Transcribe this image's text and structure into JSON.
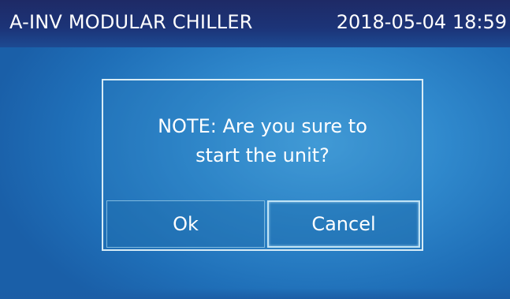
{
  "header": {
    "title": "A-INV MODULAR CHILLER",
    "datetime": "2018-05-04 18:59"
  },
  "dialog": {
    "message_line1": "NOTE: Are you sure to",
    "message_line2": "start the unit?",
    "ok_label": "Ok",
    "cancel_label": "Cancel"
  },
  "colors": {
    "title_bar": "#1c3478",
    "screen_bg": "#2f88cc",
    "dialog_border": "#d8ecf6",
    "text": "#ffffff"
  }
}
